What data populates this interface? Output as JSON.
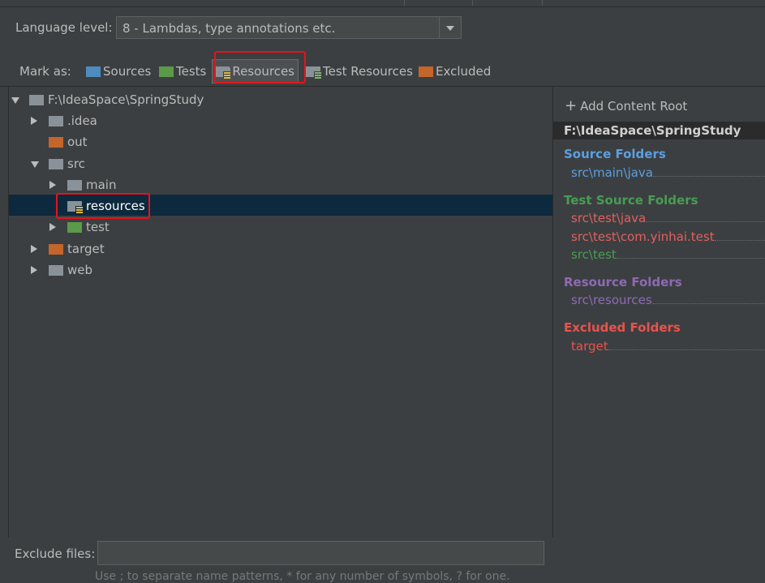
{
  "language": {
    "label": "Language level:",
    "value": "8 - Lambdas, type annotations etc."
  },
  "mark_as": {
    "label": "Mark as:",
    "buttons": [
      {
        "label": "Sources",
        "color": "#4e8bbf"
      },
      {
        "label": "Tests",
        "color": "#5b9a4b"
      },
      {
        "label": "Resources",
        "color": "#8a9299"
      },
      {
        "label": "Test Resources",
        "color": "#8a9299"
      },
      {
        "label": "Excluded",
        "color": "#c4652c"
      }
    ]
  },
  "tree": {
    "root": "F:\\IdeaSpace\\SpringStudy",
    "nodes": [
      {
        "name": ".idea",
        "icon": "folder-gray"
      },
      {
        "name": "out",
        "icon": "folder-orange"
      },
      {
        "name": "src",
        "icon": "folder-gray"
      },
      {
        "name": "main",
        "icon": "folder-gray"
      },
      {
        "name": "resources",
        "icon": "folder-resources"
      },
      {
        "name": "test",
        "icon": "folder-green"
      },
      {
        "name": "target",
        "icon": "folder-orange"
      },
      {
        "name": "web",
        "icon": "folder-gray"
      }
    ]
  },
  "right_panel": {
    "add_root": "Add Content Root",
    "root_path": "F:\\IdeaSpace\\SpringStudy",
    "source": {
      "title": "Source Folders",
      "items": [
        "src\\main\\java"
      ]
    },
    "test_source": {
      "title": "Test Source Folders",
      "items": [
        "src\\test\\java",
        "src\\test\\com.yinhai.test",
        "src\\test"
      ]
    },
    "resource": {
      "title": "Resource Folders",
      "items": [
        "src\\resources"
      ]
    },
    "excluded": {
      "title": "Excluded Folders",
      "items": [
        "target"
      ]
    }
  },
  "exclude": {
    "label": "Exclude files:",
    "value": "",
    "hint": "Use ; to separate name patterns, * for any number of symbols, ? for one."
  }
}
